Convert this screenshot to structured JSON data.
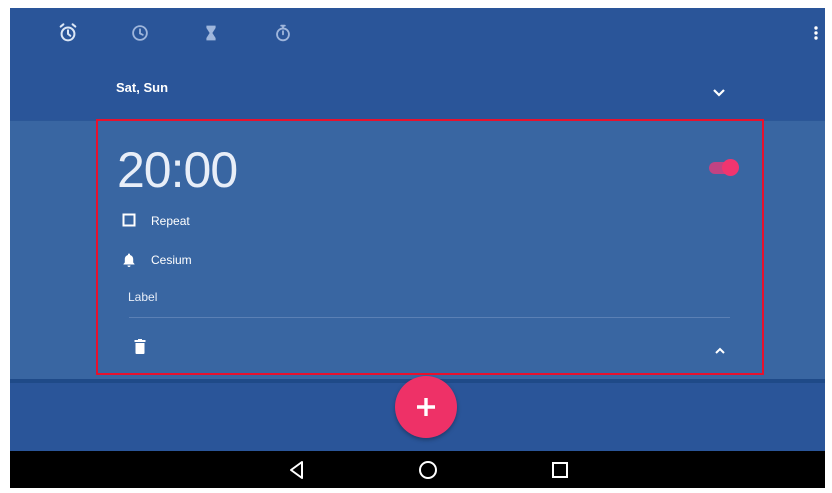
{
  "tabs": [
    {
      "name": "alarm",
      "icon": "alarm-clock-icon",
      "selected": true
    },
    {
      "name": "clock",
      "icon": "clock-icon",
      "selected": false
    },
    {
      "name": "timer",
      "icon": "hourglass-icon",
      "selected": false
    },
    {
      "name": "stopwatch",
      "icon": "stopwatch-icon",
      "selected": false
    }
  ],
  "collapsed_alarm": {
    "days": "Sat, Sun"
  },
  "expanded_alarm": {
    "time": "20:00",
    "enabled": true,
    "repeat_label": "Repeat",
    "ringtone": "Cesium",
    "label_placeholder": "Label"
  },
  "colors": {
    "background": "#2b5797",
    "card": "#3966a2",
    "accent": "#ee3167",
    "highlight_border": "#e8112d"
  }
}
